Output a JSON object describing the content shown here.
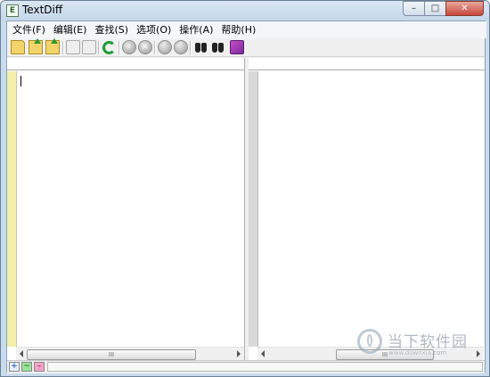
{
  "window": {
    "title": "TextDiff",
    "icon_text": "E",
    "minimize_glyph": "–",
    "maximize_glyph": "□",
    "close_glyph": "✕"
  },
  "menubar": {
    "items": [
      "文件(F)",
      "编辑(E)",
      "查找(S)",
      "选项(O)",
      "操作(A)",
      "帮助(H)"
    ]
  },
  "toolbar": {
    "icons": [
      "new-folder-icon",
      "open-folder-icon",
      "open-folder-icon",
      "save-icon",
      "save-as-icon",
      "refresh-icon",
      "go-back-icon",
      "cancel-icon",
      "go-down-icon",
      "go-up-icon",
      "find-icon",
      "find-next-icon",
      "help-book-icon"
    ]
  },
  "scrollbar": {
    "thumb_grip": "III"
  },
  "statusbar": {
    "added": "+",
    "changed": "~",
    "removed": "–"
  },
  "watermark": {
    "text": "当下软件园",
    "url": "www.downxia.com"
  },
  "colors": {
    "left_gutter": "#f3efaa",
    "right_gutter": "#d9d9d9",
    "added": "#e6f0ff",
    "changed": "#9be29b",
    "removed": "#f5a3c7"
  }
}
